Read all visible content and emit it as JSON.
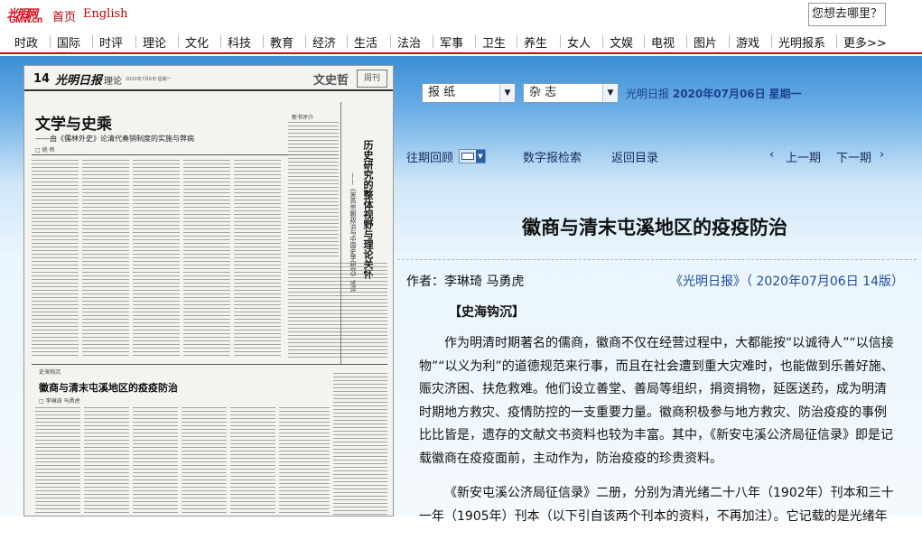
{
  "brand": {
    "logo_cn": "光明网",
    "logo_en": "GMW.cn",
    "color": "#d7000f"
  },
  "toplinks": {
    "home": "首页",
    "english": "English"
  },
  "search": {
    "label": "您想去哪里？"
  },
  "nav": [
    "时政",
    "国际",
    "时评",
    "理论",
    "文化",
    "科技",
    "教育",
    "经济",
    "生活",
    "法治",
    "军事",
    "卫生",
    "养生",
    "女人",
    "文娱",
    "电视",
    "图片",
    "游戏",
    "光明报系",
    "更多>>"
  ],
  "paper_page": {
    "page_no": "14",
    "paper_name": "光明日报",
    "section": "理论",
    "meta": "2020年7月6日 星期一",
    "column": "文史哲",
    "column2": "周刊",
    "headline": "文学与史乘",
    "subhead": "——由《儒林外史》论清代奏销制度的实施与弊病",
    "byline1": "□ 姚 鸣",
    "vertical_title": "历史研究的整体视野与理论关怀",
    "vertical_sub": "——《宋高宗朝政治与中国史学研究》述评",
    "tag1": "新书评介",
    "tag2": "史海钩沉",
    "headline2": "徽商与清末屯溪地区的疫疫防治",
    "byline2": "□ 李琳琦 马勇虎"
  },
  "selectors": {
    "newspaper": "报  纸",
    "magazine": "杂  志"
  },
  "dateline": {
    "paper": "光明日报",
    "date": "2020年07月06日",
    "weekday": "星期一"
  },
  "toolbar": {
    "archive": "往期回顾",
    "digital_search": "数字报检索",
    "back_to_index": "返回目录",
    "prev": "上一期",
    "next": "下一期"
  },
  "article": {
    "title": "徽商与清末屯溪地区的疫疫防治",
    "author": "作者：李琳琦  马勇虎",
    "source": "《光明日报》（ 2020年07月06日   14版）",
    "section_tag": "【史海钩沉】",
    "para1": "作为明清时期著名的儒商，徽商不仅在经营过程中，大都能按“以诚待人”“以信接物”“以义为利”的道德规范来行事，而且在社会遭到重大灾难时，也能做到乐善好施、赈灾济困、扶危救难。他们设立善堂、善局等组织，捐资捐物，延医送药，成为明清时期地方救灾、疫情防控的一支重要力量。徽商积极参与地方救灾、防治疫疫的事例比比皆是，遗存的文献文书资料也较为丰富。其中，《新安屯溪公济局征信录》即是记载徽商在疫疫面前，主动作为，防治疫疫的珍贵资料。",
    "para2": "《新安屯溪公济局征信录》二册，分别为清光绪二十八年（1902年）刊本和三十一年（1905年）刊本（以下引自该两个刊本的资料，不再加注）。它记载的是光绪年"
  }
}
